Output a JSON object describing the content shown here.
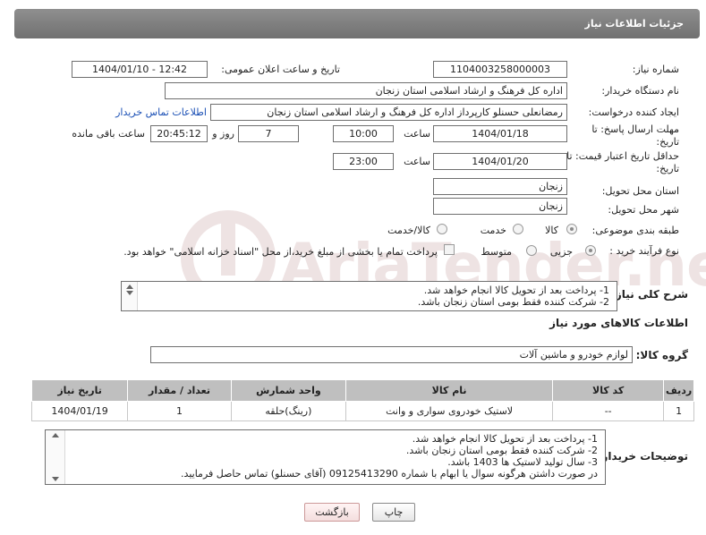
{
  "header": {
    "title": "جزئیات اطلاعات نیاز"
  },
  "watermark": {
    "text": "AriaTender.neT"
  },
  "fields": {
    "need_number_label": "شماره نیاز:",
    "need_number": "1104003258000003",
    "announce_label": "تاریخ و ساعت اعلان عمومی:",
    "announce_value": "1404/01/10 - 12:42",
    "buyer_org_label": "نام دستگاه خریدار:",
    "buyer_org": "اداره کل فرهنگ و ارشاد اسلامی استان زنجان",
    "requester_label": "ایجاد کننده درخواست:",
    "requester": "رمضانعلی حسنلو کارپرداز اداره کل فرهنگ و ارشاد اسلامی استان زنجان",
    "buyer_contact_link": "اطلاعات تماس خریدار",
    "reply_deadline_label_1": "مهلت ارسال پاسخ: تا",
    "reply_deadline_label_2": "تاریخ:",
    "reply_date": "1404/01/18",
    "time_label": "ساعت",
    "reply_time": "10:00",
    "days_value": "7",
    "days_label": "روز و",
    "remaining_time": "20:45:12",
    "remaining_label": "ساعت باقی مانده",
    "price_validity_label_1": "حداقل تاریخ اعتبار قیمت: تا",
    "price_validity_label_2": "تاریخ:",
    "price_date": "1404/01/20",
    "price_time": "23:00",
    "delivery_province_label": "استان محل تحویل:",
    "delivery_province": "زنجان",
    "delivery_city_label": "شهر محل تحویل:",
    "delivery_city": "زنجان",
    "category_label": "طبقه بندی موضوعی:",
    "category_options": [
      "کالا",
      "خدمت",
      "کالا/خدمت"
    ],
    "category_selected": "کالا",
    "process_label": "نوع فرآیند خرید :",
    "process_options": [
      "جزیی",
      "متوسط"
    ],
    "process_selected": "جزیی",
    "payment_note": "پرداخت تمام یا بخشی از مبلغ خرید،از محل \"اسناد خزانه اسلامی\" خواهد بود."
  },
  "summary": {
    "label": "شرح کلی نیاز:",
    "lines": [
      "1-    پرداخت بعد از تحویل کالا انجام خواهد شد.",
      "2-    شرکت کننده فقط بومی استان زنجان باشد."
    ]
  },
  "goods_section": {
    "title": "اطلاعات کالاهای مورد نیاز",
    "group_label": "گروه کالا:",
    "group_value": "لوازم خودرو و ماشین آلات"
  },
  "table": {
    "headers": [
      "ردیف",
      "کد کالا",
      "نام کالا",
      "واحد شمارش",
      "تعداد / مقدار",
      "تاریخ نیاز"
    ],
    "rows": [
      [
        "1",
        "--",
        "لاستیک خودروی سواری و وانت",
        "(رینگ)حلقه",
        "1",
        "1404/01/19"
      ]
    ]
  },
  "buyer_notes": {
    "label": "توضیحات خریدار:",
    "lines": [
      "1-    پرداخت بعد از تحویل کالا انجام خواهد شد.",
      "2-    شرکت کننده فقط بومی استان زنجان باشد.",
      "3-    سال تولید لاستیک ها 1403 باشد.",
      "در صورت داشتن هرگونه سوال یا ابهام با شماره 09125413290 (آقای حسنلو) تماس حاصل فرمایید."
    ]
  },
  "buttons": {
    "print": "چاپ",
    "back": "بازگشت"
  }
}
